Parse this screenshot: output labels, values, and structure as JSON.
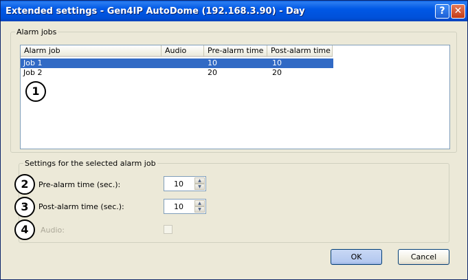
{
  "window": {
    "title": "Extended settings - Gen4IP AutoDome (192.168.3.90) - Day",
    "help_glyph": "?",
    "close_glyph": "✕"
  },
  "alarm_jobs": {
    "group_label": "Alarm jobs",
    "columns": [
      "Alarm job",
      "Audio",
      "Pre-alarm time",
      "Post-alarm time"
    ],
    "rows": [
      {
        "job": "Job  1",
        "audio": "",
        "pre": "10",
        "post": "10",
        "selected": true
      },
      {
        "job": "Job  2",
        "audio": "",
        "pre": "20",
        "post": "20",
        "selected": false
      }
    ]
  },
  "settings": {
    "group_label": "Settings for the selected alarm job",
    "pre_label": "Pre-alarm time (sec.):",
    "pre_value": "10",
    "post_label": "Post-alarm time (sec.):",
    "post_value": "10",
    "audio_label": "Audio:",
    "audio_checked": false
  },
  "callouts": [
    "1",
    "2",
    "3",
    "4"
  ],
  "buttons": {
    "ok": "OK",
    "cancel": "Cancel"
  },
  "icons": {
    "spin_up": "▲",
    "spin_down": "▼"
  }
}
